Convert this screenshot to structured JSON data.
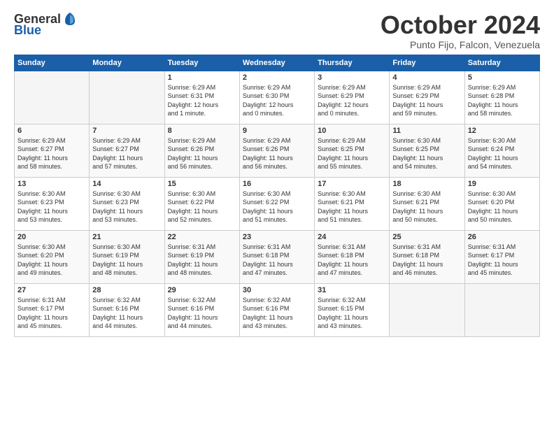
{
  "header": {
    "logo_general": "General",
    "logo_blue": "Blue",
    "month_title": "October 2024",
    "subtitle": "Punto Fijo, Falcon, Venezuela"
  },
  "days_of_week": [
    "Sunday",
    "Monday",
    "Tuesday",
    "Wednesday",
    "Thursday",
    "Friday",
    "Saturday"
  ],
  "weeks": [
    [
      {
        "day": "",
        "info": ""
      },
      {
        "day": "",
        "info": ""
      },
      {
        "day": "1",
        "info": "Sunrise: 6:29 AM\nSunset: 6:31 PM\nDaylight: 12 hours\nand 1 minute."
      },
      {
        "day": "2",
        "info": "Sunrise: 6:29 AM\nSunset: 6:30 PM\nDaylight: 12 hours\nand 0 minutes."
      },
      {
        "day": "3",
        "info": "Sunrise: 6:29 AM\nSunset: 6:29 PM\nDaylight: 12 hours\nand 0 minutes."
      },
      {
        "day": "4",
        "info": "Sunrise: 6:29 AM\nSunset: 6:29 PM\nDaylight: 11 hours\nand 59 minutes."
      },
      {
        "day": "5",
        "info": "Sunrise: 6:29 AM\nSunset: 6:28 PM\nDaylight: 11 hours\nand 58 minutes."
      }
    ],
    [
      {
        "day": "6",
        "info": "Sunrise: 6:29 AM\nSunset: 6:27 PM\nDaylight: 11 hours\nand 58 minutes."
      },
      {
        "day": "7",
        "info": "Sunrise: 6:29 AM\nSunset: 6:27 PM\nDaylight: 11 hours\nand 57 minutes."
      },
      {
        "day": "8",
        "info": "Sunrise: 6:29 AM\nSunset: 6:26 PM\nDaylight: 11 hours\nand 56 minutes."
      },
      {
        "day": "9",
        "info": "Sunrise: 6:29 AM\nSunset: 6:26 PM\nDaylight: 11 hours\nand 56 minutes."
      },
      {
        "day": "10",
        "info": "Sunrise: 6:29 AM\nSunset: 6:25 PM\nDaylight: 11 hours\nand 55 minutes."
      },
      {
        "day": "11",
        "info": "Sunrise: 6:30 AM\nSunset: 6:25 PM\nDaylight: 11 hours\nand 54 minutes."
      },
      {
        "day": "12",
        "info": "Sunrise: 6:30 AM\nSunset: 6:24 PM\nDaylight: 11 hours\nand 54 minutes."
      }
    ],
    [
      {
        "day": "13",
        "info": "Sunrise: 6:30 AM\nSunset: 6:23 PM\nDaylight: 11 hours\nand 53 minutes."
      },
      {
        "day": "14",
        "info": "Sunrise: 6:30 AM\nSunset: 6:23 PM\nDaylight: 11 hours\nand 53 minutes."
      },
      {
        "day": "15",
        "info": "Sunrise: 6:30 AM\nSunset: 6:22 PM\nDaylight: 11 hours\nand 52 minutes."
      },
      {
        "day": "16",
        "info": "Sunrise: 6:30 AM\nSunset: 6:22 PM\nDaylight: 11 hours\nand 51 minutes."
      },
      {
        "day": "17",
        "info": "Sunrise: 6:30 AM\nSunset: 6:21 PM\nDaylight: 11 hours\nand 51 minutes."
      },
      {
        "day": "18",
        "info": "Sunrise: 6:30 AM\nSunset: 6:21 PM\nDaylight: 11 hours\nand 50 minutes."
      },
      {
        "day": "19",
        "info": "Sunrise: 6:30 AM\nSunset: 6:20 PM\nDaylight: 11 hours\nand 50 minutes."
      }
    ],
    [
      {
        "day": "20",
        "info": "Sunrise: 6:30 AM\nSunset: 6:20 PM\nDaylight: 11 hours\nand 49 minutes."
      },
      {
        "day": "21",
        "info": "Sunrise: 6:30 AM\nSunset: 6:19 PM\nDaylight: 11 hours\nand 48 minutes."
      },
      {
        "day": "22",
        "info": "Sunrise: 6:31 AM\nSunset: 6:19 PM\nDaylight: 11 hours\nand 48 minutes."
      },
      {
        "day": "23",
        "info": "Sunrise: 6:31 AM\nSunset: 6:18 PM\nDaylight: 11 hours\nand 47 minutes."
      },
      {
        "day": "24",
        "info": "Sunrise: 6:31 AM\nSunset: 6:18 PM\nDaylight: 11 hours\nand 47 minutes."
      },
      {
        "day": "25",
        "info": "Sunrise: 6:31 AM\nSunset: 6:18 PM\nDaylight: 11 hours\nand 46 minutes."
      },
      {
        "day": "26",
        "info": "Sunrise: 6:31 AM\nSunset: 6:17 PM\nDaylight: 11 hours\nand 45 minutes."
      }
    ],
    [
      {
        "day": "27",
        "info": "Sunrise: 6:31 AM\nSunset: 6:17 PM\nDaylight: 11 hours\nand 45 minutes."
      },
      {
        "day": "28",
        "info": "Sunrise: 6:32 AM\nSunset: 6:16 PM\nDaylight: 11 hours\nand 44 minutes."
      },
      {
        "day": "29",
        "info": "Sunrise: 6:32 AM\nSunset: 6:16 PM\nDaylight: 11 hours\nand 44 minutes."
      },
      {
        "day": "30",
        "info": "Sunrise: 6:32 AM\nSunset: 6:16 PM\nDaylight: 11 hours\nand 43 minutes."
      },
      {
        "day": "31",
        "info": "Sunrise: 6:32 AM\nSunset: 6:15 PM\nDaylight: 11 hours\nand 43 minutes."
      },
      {
        "day": "",
        "info": ""
      },
      {
        "day": "",
        "info": ""
      }
    ]
  ]
}
